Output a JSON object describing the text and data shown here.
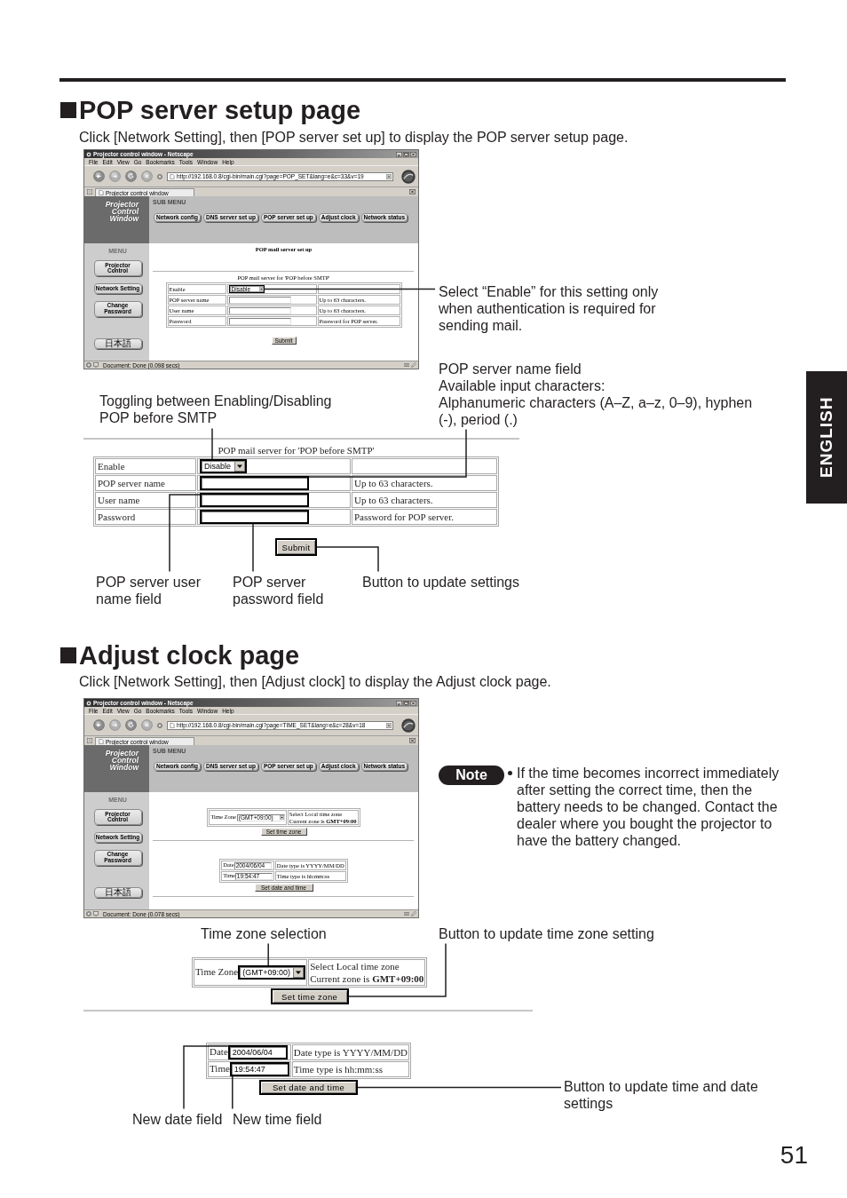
{
  "pop_page": {
    "title": "POP server setup page",
    "intro": "Click [Network Setting], then [POP server set up] to display the POP server setup page.",
    "browser": {
      "title": "Projector control window - Netscape",
      "menu_bar": [
        "File",
        "Edit",
        "View",
        "Go",
        "Bookmarks",
        "Tools",
        "Window",
        "Help"
      ],
      "url": "http://192.168.0.8/cgi-bin/main.cgi?page=POP_SET&lang=e&c=33&v=19",
      "tab": "Projector control window",
      "logo": [
        "Projector",
        "Control",
        "Window"
      ],
      "submenu_heading": "SUB MENU",
      "submenu": [
        "Network config",
        "DNS server set up",
        "POP server set up",
        "Adjust clock",
        "Network status"
      ],
      "menu_heading": "MENU",
      "menu": [
        {
          "lines": [
            "Projector",
            "Control"
          ]
        },
        {
          "lines": [
            "Network Setting"
          ]
        },
        {
          "lines": [
            "Change",
            "Password"
          ]
        },
        {
          "lines": [
            "日本語"
          ]
        }
      ],
      "status": "Document: Done (0.098 secs)",
      "content": {
        "heading": "POP mail server set up",
        "caption": "POP mail server for 'POP before SMTP'",
        "rows": [
          {
            "kind": "select",
            "label": "Enable",
            "value": "Disable",
            "highlighted": true
          },
          {
            "kind": "input",
            "label": "POP server name",
            "note": "Up to 63 characters.",
            "highlighted": false
          },
          {
            "kind": "input",
            "label": "User name",
            "note": "Up to 63 characters.",
            "highlighted": false
          },
          {
            "kind": "input",
            "label": "Password",
            "note": "Password for POP server.",
            "highlighted": false
          }
        ],
        "button": "Submit"
      }
    },
    "side_notes": [
      {
        "lines": [
          "Select “Enable” for this setting only when authentication is required for sending mail."
        ]
      },
      {
        "lines": [
          "POP server name field",
          "Available input characters:",
          "Alphanumeric characters (A–Z, a–z, 0–9), hyphen (-), period (.)"
        ]
      }
    ],
    "toggle_note": "Toggling between Enabling/Disabling POP before SMTP",
    "detail": {
      "caption": "POP mail server for 'POP before SMTP'",
      "rows": [
        {
          "kind": "select",
          "label": "Enable",
          "value": "Disable"
        },
        {
          "kind": "input",
          "label": "POP server name",
          "note": "Up to 63 characters."
        },
        {
          "kind": "input",
          "label": "User name",
          "note": "Up to 63 characters."
        },
        {
          "kind": "input",
          "label": "Password",
          "note": "Password for POP server."
        }
      ],
      "button": "Submit"
    },
    "bottom_notes": [
      "POP server user name field",
      "POP server password field",
      "Button to update settings"
    ]
  },
  "clock_page": {
    "title": "Adjust clock page",
    "intro": "Click [Network Setting], then [Adjust clock] to display the Adjust clock page.",
    "browser": {
      "title": "Projector control window - Netscape",
      "menu_bar": [
        "File",
        "Edit",
        "View",
        "Go",
        "Bookmarks",
        "Tools",
        "Window",
        "Help"
      ],
      "url": "http://192.168.0.8/cgi-bin/main.cgi?page=TIME_SET&lang=e&c=28&v=18",
      "tab": "Projector control window",
      "logo": [
        "Projector",
        "Control",
        "Window"
      ],
      "submenu_heading": "SUB MENU",
      "submenu": [
        "Network config",
        "DNS server set up",
        "POP server set up",
        "Adjust clock",
        "Network status"
      ],
      "menu_heading": "MENU",
      "menu": [
        {
          "lines": [
            "Projector",
            "Control"
          ]
        },
        {
          "lines": [
            "Network Setting"
          ]
        },
        {
          "lines": [
            "Change",
            "Password"
          ]
        },
        {
          "lines": [
            "日本語"
          ]
        }
      ],
      "status": "Document: Done (0.078 secs)",
      "content": {
        "zone": {
          "label": "Time Zone",
          "value": "(GMT+09:00)",
          "notes": [
            "Select Local time zone",
            "Current zone is **GMT+09:00**"
          ],
          "button": "Set time zone"
        },
        "date": {
          "rows": [
            {
              "label": "Date",
              "value": "2004/06/04",
              "note": "Date type is YYYY/MM/DD"
            },
            {
              "label": "Time",
              "value": "19:54:47",
              "note": "Time type is hh:mm:ss"
            }
          ],
          "button": "Set date and time"
        }
      }
    },
    "note": {
      "badge": "Note",
      "text": "If the time becomes incorrect immediately after setting the correct time, then the battery needs to be changed. Contact the dealer where you bought the projector to have the battery changed."
    },
    "top_notes": [
      "Time zone selection",
      "Button to update time zone setting"
    ],
    "zone_detail": {
      "label": "Time Zone",
      "value": "(GMT+09:00)",
      "notes": [
        "Select Local time zone",
        "Current zone is **GMT+09:00**"
      ],
      "button": "Set time zone"
    },
    "date_detail": {
      "rows": [
        {
          "label": "Date",
          "value": "2004/06/04",
          "note": "Date type is YYYY/MM/DD"
        },
        {
          "label": "Time",
          "value": "19:54:47",
          "note": "Time type is hh:mm:ss"
        }
      ],
      "button": "Set date and time"
    },
    "side_note": "Button to update time and date settings",
    "bottom_notes": [
      "New date field",
      "New time field"
    ]
  },
  "language_tab": "ENGLISH",
  "page_number": "51"
}
